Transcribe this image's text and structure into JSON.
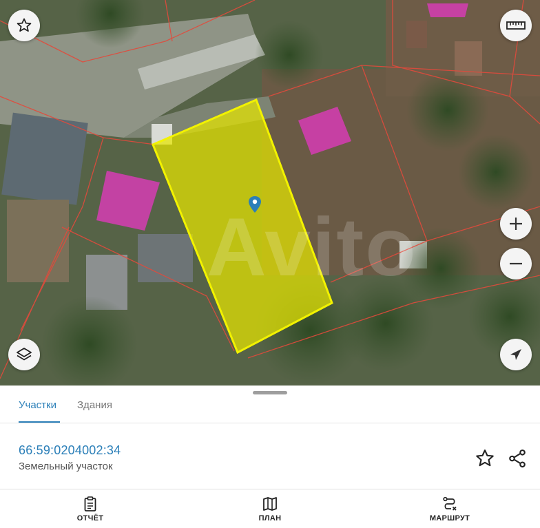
{
  "map": {
    "watermark": "Avito",
    "buttons": {
      "favorite": "star-icon",
      "ruler": "ruler-icon",
      "zoom_in": "plus-icon",
      "zoom_out": "minus-icon",
      "layers": "layers-icon",
      "locate": "navigation-arrow-icon"
    },
    "colors": {
      "selected_parcel": "#e6e600",
      "building": "#d63cb4",
      "boundary": "#e24a3c",
      "marker": "#2b7fb8"
    }
  },
  "tabs": [
    {
      "label": "Участки",
      "active": true
    },
    {
      "label": "Здания",
      "active": false
    }
  ],
  "parcel": {
    "cadastral_number": "66:59:0204002:34",
    "type": "Земельный участок"
  },
  "bottom_nav": [
    {
      "label": "ОТЧЁТ",
      "icon": "clipboard-icon"
    },
    {
      "label": "ПЛАН",
      "icon": "map-book-icon"
    },
    {
      "label": "МАРШРУТ",
      "icon": "route-icon"
    }
  ],
  "accent_color": "#2b7fb8"
}
